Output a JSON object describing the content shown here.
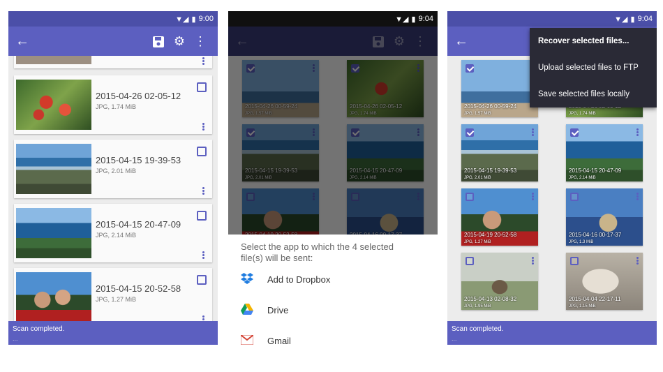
{
  "status": {
    "time1": "9:00",
    "time2": "9:04",
    "time3": "9:04"
  },
  "colors": {
    "primary": "#5c5fc0",
    "status": "#4b4fa8",
    "menu_bg": "#2a2a36"
  },
  "appbar": {
    "back_icon": "arrow-left-icon",
    "save_icon": "save-icon",
    "settings_icon": "gear-icon",
    "more_icon": "more-vert-icon"
  },
  "list_files": [
    {
      "date": "2015-04-26 02-05-12",
      "meta": "JPG, 1.74 MiB"
    },
    {
      "date": "2015-04-15 19-39-53",
      "meta": "JPG, 2.01 MiB"
    },
    {
      "date": "2015-04-15 20-47-09",
      "meta": "JPG, 2.14 MiB"
    },
    {
      "date": "2015-04-15 20-52-58",
      "meta": "JPG, 1.27 MiB"
    }
  ],
  "toast": {
    "text": "Scan completed.",
    "detail": "..."
  },
  "share_sheet": {
    "prompt": "Select the app to which the 4 selected file(s) will be sent:",
    "options": [
      {
        "label": "Add to Dropbox",
        "icon": "dropbox-icon"
      },
      {
        "label": "Drive",
        "icon": "drive-icon"
      },
      {
        "label": "Gmail",
        "icon": "gmail-icon"
      }
    ]
  },
  "grid_files": [
    {
      "date": "2015-04-26 00-59-24",
      "meta": "JPG, 1.57 MiB",
      "checked": true
    },
    {
      "date": "2015-04-26 02-05-12",
      "meta": "JPG, 1.74 MiB",
      "checked": true
    },
    {
      "date": "2015-04-15 19-39-53",
      "meta": "JPG, 2.01 MiB",
      "checked": true
    },
    {
      "date": "2015-04-15 20-47-09",
      "meta": "JPG, 2.14 MiB",
      "checked": true
    },
    {
      "date": "2015-04-19 20-52-58",
      "meta": "JPG, 1.27 MiB",
      "checked": false
    },
    {
      "date": "2015-04-16 00-17-37",
      "meta": "JPG, 1.3 MiB",
      "checked": false
    },
    {
      "date": "2015-04-13 02-08-32",
      "meta": "JPG, 1.95 MiB",
      "checked": false
    },
    {
      "date": "2015-04-04 22-17-11",
      "meta": "JPG, 1.15 MiB",
      "checked": false
    }
  ],
  "overflow_menu": {
    "items": [
      "Recover selected files...",
      "Upload selected files to FTP",
      "Save selected files locally"
    ]
  }
}
